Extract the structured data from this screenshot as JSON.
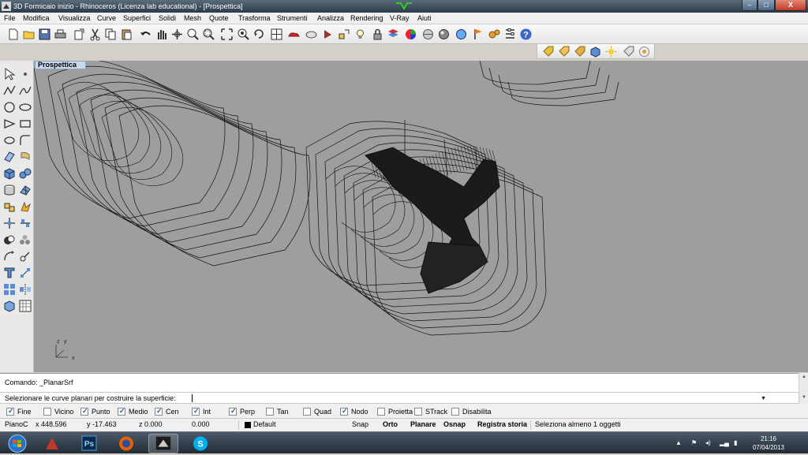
{
  "window": {
    "title": "3D Formicaio inizio  - Rhinoceros (Licenza lab educational) - [Prospettica]",
    "min_label": "–",
    "max_label": "□",
    "close_label": "X"
  },
  "menu": [
    "File",
    "Modifica",
    "Visualizza",
    "Curve",
    "Superfici",
    "Solidi",
    "Mesh",
    "Quote",
    "Trasforma",
    "Strumenti",
    "Analizza",
    "Rendering",
    "V-Ray",
    "Aiuti"
  ],
  "viewport": {
    "label": "Prospettica",
    "axis_z": "z",
    "axis_y": "y",
    "axis_x": "x"
  },
  "command": {
    "history": "Comando: _PlanarSrf",
    "prompt": "Selezionare le curve planari per costruire la superficie:"
  },
  "osnaps": [
    {
      "label": "Fine",
      "checked": true
    },
    {
      "label": "Vicino",
      "checked": false
    },
    {
      "label": "Punto",
      "checked": true
    },
    {
      "label": "Medio",
      "checked": true
    },
    {
      "label": "Cen",
      "checked": true
    },
    {
      "label": "Int",
      "checked": true
    },
    {
      "label": "Perp",
      "checked": true
    },
    {
      "label": "Tan",
      "checked": false
    },
    {
      "label": "Quad",
      "checked": false
    },
    {
      "label": "Nodo",
      "checked": true
    },
    {
      "label": "Proietta",
      "checked": false
    },
    {
      "label": "STrack",
      "checked": false
    },
    {
      "label": "Disabilita",
      "checked": false
    }
  ],
  "status": {
    "cplane": "PianoC",
    "x": "x 448.596",
    "y": "y -17.463",
    "z": "z 0.000",
    "d": "0.000",
    "layer": "Default",
    "snap": "Snap",
    "orto": "Orto",
    "planare": "Planare",
    "osnap": "Osnap",
    "history": "Registra storia",
    "message": "Seleziona almeno 1 oggetti"
  },
  "taskbar": {
    "time": "21:16",
    "date": "07/04/2013",
    "ps_label": "Ps"
  }
}
